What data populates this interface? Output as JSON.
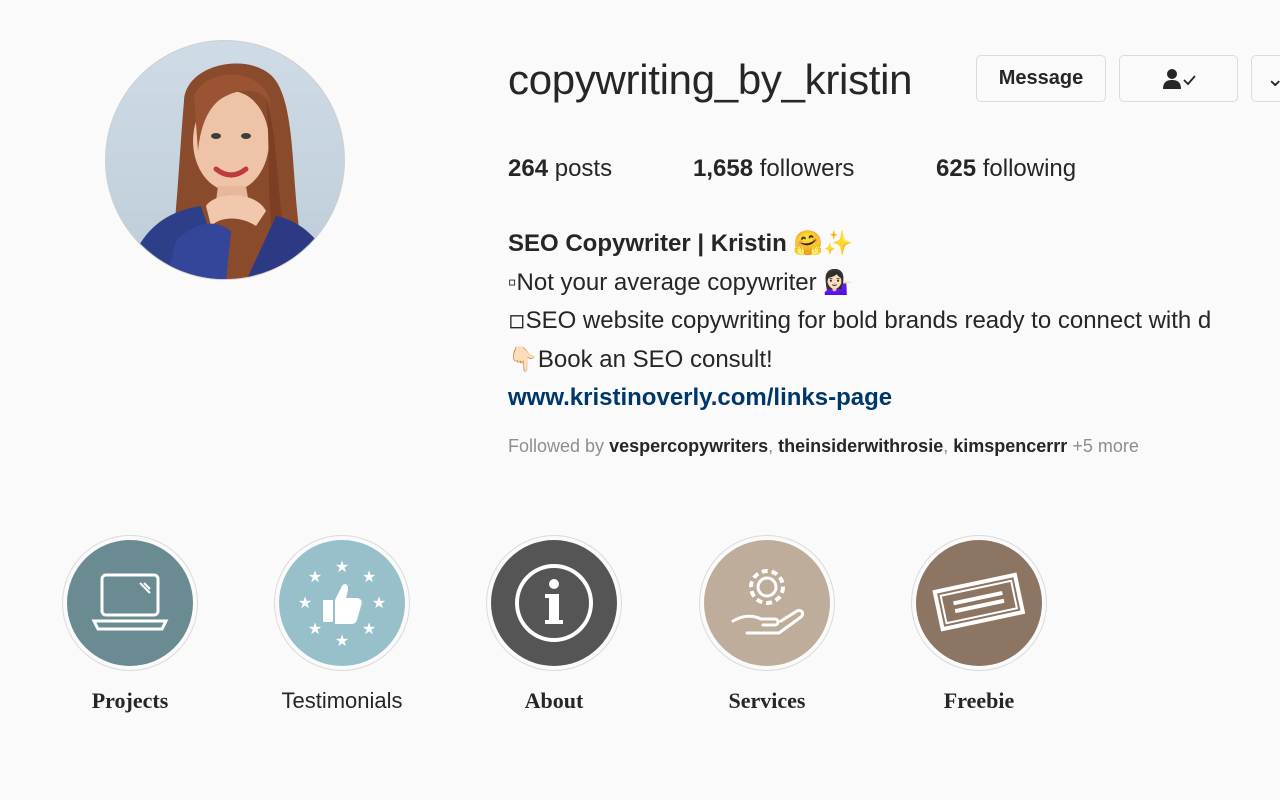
{
  "profile": {
    "username": "copywriting_by_kristin",
    "buttons": {
      "message": "Message",
      "more": "⌄"
    },
    "stats": [
      {
        "count": "264",
        "label": "posts"
      },
      {
        "count": "1,658",
        "label": "followers"
      },
      {
        "count": "625",
        "label": "following"
      }
    ],
    "bio": {
      "name": "SEO Copywriter | Kristin 🤗✨",
      "lines": [
        "▫Not your average copywriter 💁🏻‍♀️",
        "◽SEO website copywriting for bold brands ready to connect with d",
        "👇🏻Book an SEO consult!"
      ],
      "link": "www.kristinoverly.com/links-page"
    },
    "followed_by": {
      "prefix": "Followed by",
      "users": [
        "vespercopywriters",
        "theinsiderwithrosie",
        "kimspencerrr"
      ],
      "more": "+5 more"
    }
  },
  "highlights": [
    {
      "label": "Projects",
      "icon": "laptop-icon",
      "color": "#6b8b93"
    },
    {
      "label": "Testimonials",
      "icon": "thumbs-up-stars-icon",
      "color": "#97c0cb"
    },
    {
      "label": "About",
      "icon": "info-icon",
      "color": "#555555"
    },
    {
      "label": "Services",
      "icon": "gear-hand-icon",
      "color": "#bfad9c"
    },
    {
      "label": "Freebie",
      "icon": "free-stamp-icon",
      "color": "#8d7563"
    }
  ],
  "colors": {
    "link": "#00376b",
    "text": "#262626",
    "muted": "#8e8e8e",
    "border": "#dbdbdb"
  }
}
